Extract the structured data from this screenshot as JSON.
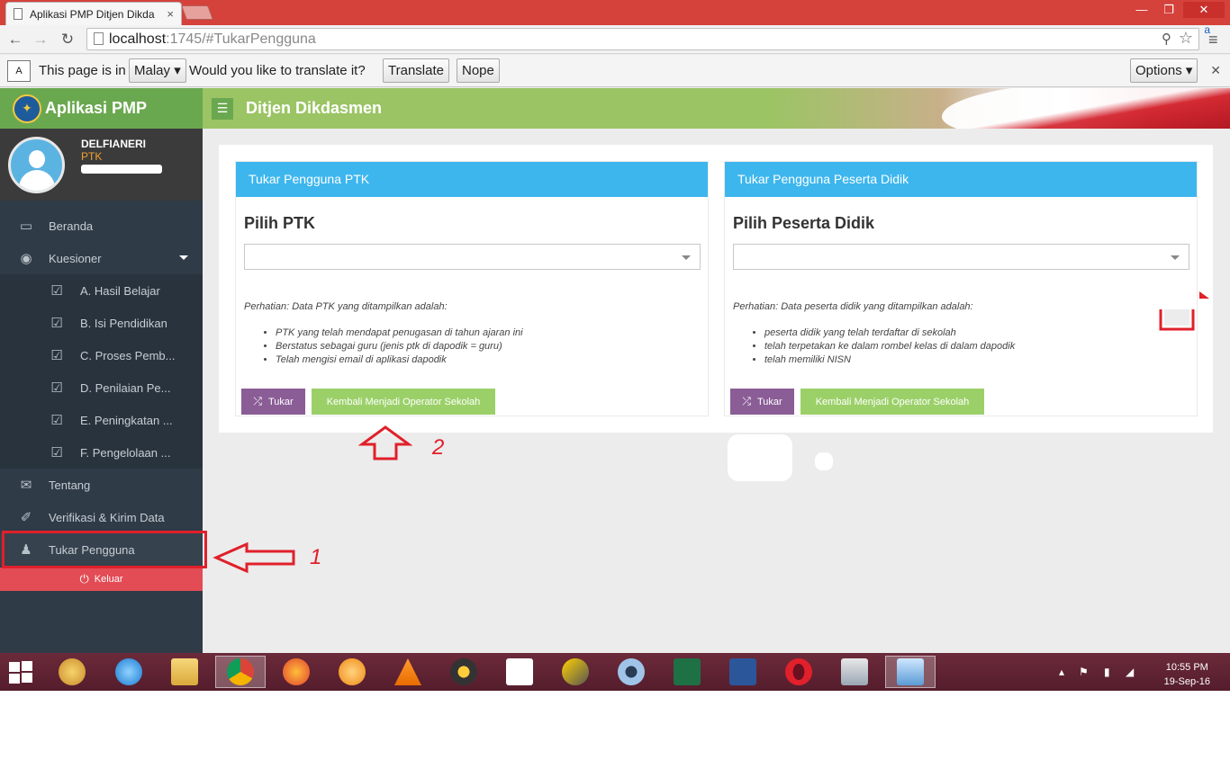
{
  "browser": {
    "tab_title": "Aplikasi PMP Ditjen Dikda",
    "tab_close": "×",
    "url_host": "localhost",
    "url_path": ":1745/#TukarPengguna",
    "translate_icon_letter": "A",
    "ext_letter": "a"
  },
  "translate_bar": {
    "text1": "This page is in",
    "language": "Malay",
    "question": "Would you like to translate it?",
    "translate_label": "Translate",
    "nope_label": "Nope",
    "options_label": "Options"
  },
  "sidebar": {
    "brand": "Aplikasi PMP",
    "user_name": "DELFIANERI",
    "user_role": "PTK",
    "items": [
      {
        "label": "Beranda",
        "icon": "monitor-icon"
      },
      {
        "label": "Kuesioner",
        "icon": "binoculars-icon"
      },
      {
        "label": "A. Hasil Belajar",
        "icon": "checkbox-icon"
      },
      {
        "label": "B. Isi Pendidikan",
        "icon": "checkbox-icon"
      },
      {
        "label": "C. Proses Pemb...",
        "icon": "checkbox-icon"
      },
      {
        "label": "D. Penilaian Pe...",
        "icon": "checkbox-icon"
      },
      {
        "label": "E. Peningkatan ...",
        "icon": "checkbox-icon"
      },
      {
        "label": "F. Pengelolaan ...",
        "icon": "checkbox-icon"
      },
      {
        "label": "Tentang",
        "icon": "comments-icon"
      },
      {
        "label": "Verifikasi & Kirim Data",
        "icon": "paperclip-icon"
      },
      {
        "label": "Tukar Pengguna",
        "icon": "users-icon"
      }
    ],
    "logout_label": "Keluar"
  },
  "topbar": {
    "title": "Ditjen Dikdasmen"
  },
  "panels": {
    "ptk": {
      "header": "Tukar Pengguna PTK",
      "title": "Pilih PTK",
      "note": "Perhatian: Data PTK yang ditampilkan adalah:",
      "bullets": [
        "PTK yang telah mendapat penugasan di tahun ajaran ini",
        "Berstatus sebagai guru (jenis ptk di dapodik = guru)",
        "Telah mengisi email di aplikasi dapodik"
      ],
      "tukar_label": "Tukar",
      "back_label": "Kembali Menjadi Operator Sekolah"
    },
    "pd": {
      "header": "Tukar Pengguna Peserta Didik",
      "title": "Pilih Peserta Didik",
      "note": "Perhatian: Data peserta didik yang ditampilkan adalah:",
      "bullets": [
        "peserta didik yang telah terdaftar di sekolah",
        "telah terpetakan ke dalam rombel kelas di dalam dapodik",
        "telah memiliki NISN"
      ],
      "tukar_label": "Tukar",
      "back_label": "Kembali Menjadi Operator Sekolah"
    }
  },
  "annotations": {
    "label1": "1",
    "label2": "2",
    "color": "#e0202a"
  },
  "taskbar": {
    "time": "10:55 PM",
    "date": "19-Sep-16"
  },
  "colors": {
    "sidebar": "#2f3b47",
    "brand_green": "#6aa84f",
    "panel_header": "#3db6ee",
    "tukar_btn": "#8a5d96",
    "back_btn": "#9bd069",
    "logout": "#e34b55"
  }
}
